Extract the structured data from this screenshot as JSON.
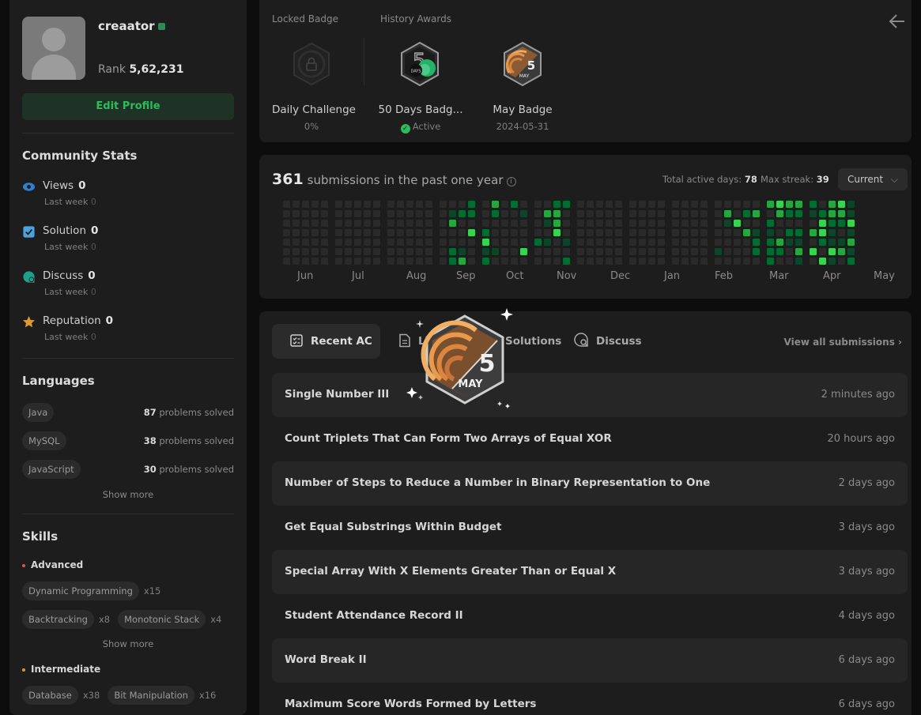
{
  "profile": {
    "username": "creaator",
    "rank_label": "Rank",
    "rank_value": "5,62,231",
    "edit_label": "Edit Profile"
  },
  "community": {
    "title": "Community Stats",
    "views_label": "Views",
    "views_value": "0",
    "views_sub": "Last week",
    "views_sub_value": "0",
    "solution_label": "Solution",
    "solution_value": "0",
    "solution_sub": "Last week",
    "solution_sub_value": "0",
    "discuss_label": "Discuss",
    "discuss_value": "0",
    "discuss_sub": "Last week",
    "discuss_sub_value": "0",
    "reputation_label": "Reputation",
    "reputation_value": "0",
    "reputation_sub": "Last week",
    "reputation_sub_value": "0"
  },
  "languages": {
    "title": "Languages",
    "suffix": "problems solved",
    "items": [
      {
        "name": "Java",
        "count": "87"
      },
      {
        "name": "MySQL",
        "count": "38"
      },
      {
        "name": "JavaScript",
        "count": "30"
      }
    ],
    "show_more": "Show more"
  },
  "skills": {
    "title": "Skills",
    "advanced_label": "Advanced",
    "advanced": [
      {
        "name": "Dynamic Programming",
        "count": "x15"
      },
      {
        "name": "Backtracking",
        "count": "x8"
      },
      {
        "name": "Monotonic Stack",
        "count": "x4"
      }
    ],
    "show_more": "Show more",
    "intermediate_label": "Intermediate",
    "intermediate": [
      {
        "name": "Database",
        "count": "x38"
      },
      {
        "name": "Bit Manipulation",
        "count": "x16"
      }
    ]
  },
  "badges": {
    "locked_title": "Locked Badge",
    "history_title": "History Awards",
    "locked_name": "Daily Challenge",
    "locked_sub": "0%",
    "b1_name": "50 Days Badg...",
    "b1_sub": "Active",
    "b2_name": "May Badge",
    "b2_sub": "2024-05-31",
    "days_text": "DAYS",
    "badge_num": "5",
    "badge_month": "MAY"
  },
  "heatmap": {
    "count": "361",
    "text": "submissions in the past one year",
    "active_label": "Total active days:",
    "active_value": "78",
    "streak_label": "Max streak:",
    "streak_value": "39",
    "current_label": "Current",
    "months": [
      "Jun",
      "Jul",
      "Aug",
      "Sep",
      "Oct",
      "Nov",
      "Dec",
      "Jan",
      "Feb",
      "Mar",
      "Apr",
      "May"
    ]
  },
  "tabs": {
    "recent_ac": "Recent AC",
    "list": "List",
    "solutions": "Solutions",
    "discuss": "Discuss",
    "view_all": "View all submissions"
  },
  "submissions": [
    {
      "title": "Single Number III",
      "ago": "2 minutes ago"
    },
    {
      "title": "Count Triplets That Can Form Two Arrays of Equal XOR",
      "ago": "20 hours ago"
    },
    {
      "title": "Number of Steps to Reduce a Number in Binary Representation to One",
      "ago": "2 days ago"
    },
    {
      "title": "Get Equal Substrings Within Budget",
      "ago": "3 days ago"
    },
    {
      "title": "Special Array With X Elements Greater Than or Equal X",
      "ago": "3 days ago"
    },
    {
      "title": "Student Attendance Record II",
      "ago": "4 days ago"
    },
    {
      "title": "Word Break II",
      "ago": "6 days ago"
    },
    {
      "title": "Maximum Score Words Formed by Letters",
      "ago": "6 days ago"
    }
  ],
  "colors": {
    "accent_green": "#2cbb5d",
    "cell_empty": "#2a2a2a",
    "cell_l1": "#0e4429",
    "cell_l2": "#006d32",
    "cell_l3": "#26a641",
    "cell_l4": "#39d353"
  },
  "icons": {
    "views": "eye-icon",
    "solution": "checkbox-icon",
    "discuss": "discuss-bubble-icon",
    "reputation": "star-icon",
    "back": "arrow-left-icon"
  }
}
